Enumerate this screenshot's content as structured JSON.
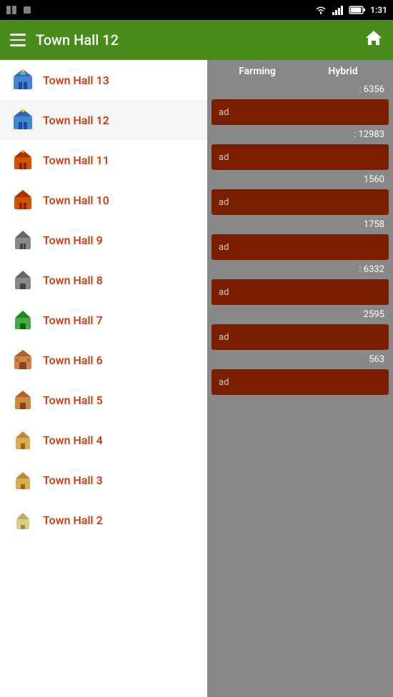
{
  "statusBar": {
    "time": "1:31",
    "batteryIcon": "🔋",
    "wifiIcon": "📶",
    "signalIcon": "📡"
  },
  "appBar": {
    "title": "Town Hall 12",
    "menuIcon": "menu",
    "homeIcon": "🏠"
  },
  "sidebar": {
    "items": [
      {
        "id": 13,
        "label": "Town Hall 13",
        "emoji": "🏯"
      },
      {
        "id": 12,
        "label": "Town Hall 12",
        "emoji": "🏯"
      },
      {
        "id": 11,
        "label": "Town Hall 11",
        "emoji": "🏯"
      },
      {
        "id": 10,
        "label": "Town Hall 10",
        "emoji": "🏯"
      },
      {
        "id": 9,
        "label": "Town Hall 9",
        "emoji": "🏯"
      },
      {
        "id": 8,
        "label": "Town Hall 8",
        "emoji": "🏯"
      },
      {
        "id": 7,
        "label": "Town Hall 7",
        "emoji": "🏯"
      },
      {
        "id": 6,
        "label": "Town Hall 6",
        "emoji": "🏯"
      },
      {
        "id": 5,
        "label": "Town Hall 5",
        "emoji": "🏯"
      },
      {
        "id": 4,
        "label": "Town Hall 4",
        "emoji": "🏯"
      },
      {
        "id": 3,
        "label": "Town Hall 3",
        "emoji": "🏯"
      },
      {
        "id": 2,
        "label": "Town Hall 2",
        "emoji": "🏯"
      }
    ]
  },
  "columns": {
    "farming": "Farming",
    "hybrid": "Hybrid"
  },
  "contentSections": [
    {
      "value": ": 6356",
      "barLabel": "ad"
    },
    {
      "value": ": 12983",
      "barLabel": "ad"
    },
    {
      "value": "1560",
      "barLabel": "ad"
    },
    {
      "value": "1758",
      "barLabel": "ad"
    },
    {
      "value": ": 6332",
      "barLabel": "ad"
    },
    {
      "value": "2595",
      "barLabel": "ad"
    },
    {
      "value": "563",
      "barLabel": "ad"
    }
  ]
}
